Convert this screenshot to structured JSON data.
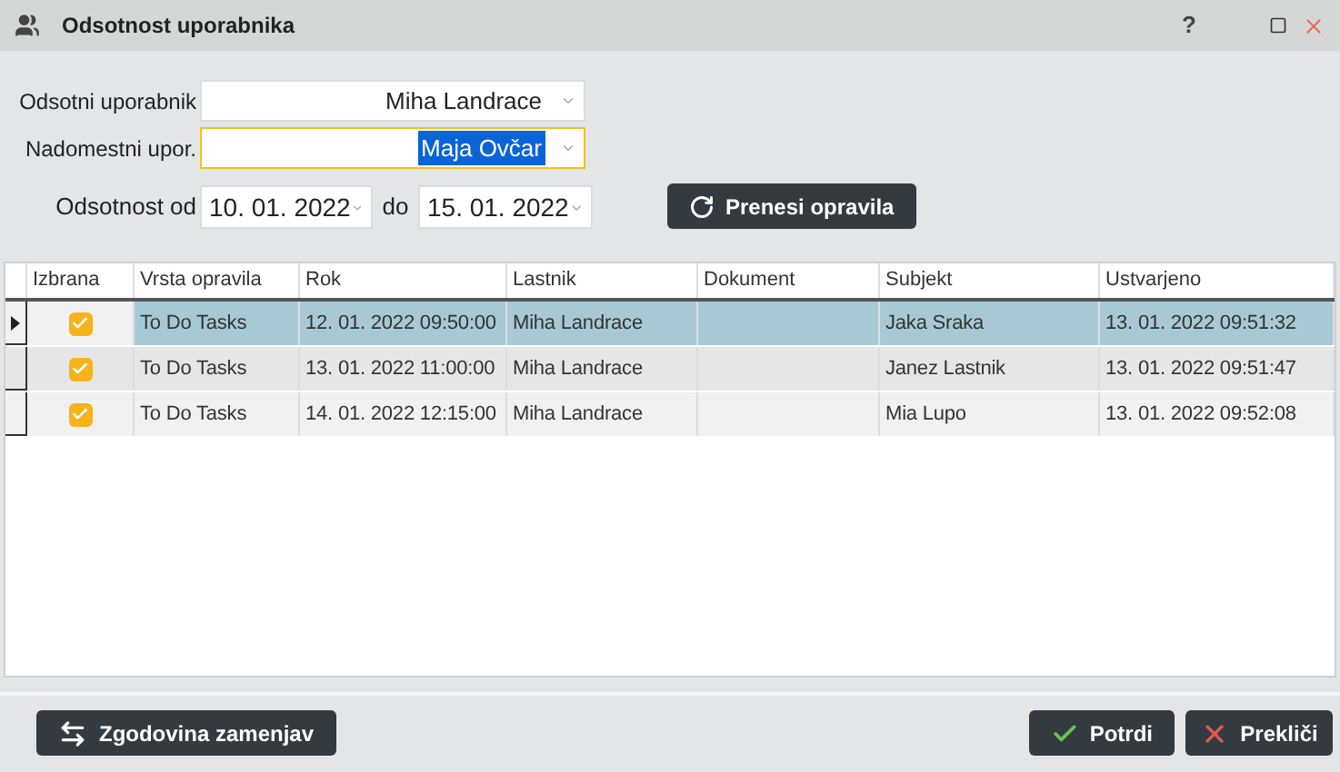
{
  "window": {
    "title": "Odsotnost uporabnika",
    "help": "?"
  },
  "form": {
    "absent_user": {
      "label": "Odsotni uporabnik",
      "value": "Miha Landrace",
      "focused": false
    },
    "substitute_user": {
      "label": "Nadomestni upor.",
      "value": "Maja Ovčar",
      "focused": true
    },
    "absence_from": {
      "label": "Odsotnost od",
      "value": "10. 01. 2022"
    },
    "to_label": "do",
    "absence_to": {
      "value": "15. 01. 2022"
    },
    "transfer_button": "Prenesi opravila"
  },
  "table": {
    "columns": [
      "Izbrana",
      "Vrsta opravila",
      "Rok",
      "Lastnik",
      "Dokument",
      "Subjekt",
      "Ustvarjeno"
    ],
    "rows": [
      {
        "selected": true,
        "checked": true,
        "type": "To Do Tasks",
        "deadline": "12. 01. 2022 09:50:00",
        "owner": "Miha Landrace",
        "subject": "Jaka Sraka",
        "created": "13. 01. 2022 09:51:32"
      },
      {
        "selected": false,
        "checked": true,
        "type": "To Do Tasks",
        "deadline": "13. 01. 2022 11:00:00",
        "owner": "Miha Landrace",
        "subject": "Janez Lastnik",
        "created": "13. 01. 2022 09:51:47"
      },
      {
        "selected": false,
        "checked": true,
        "type": "To Do Tasks",
        "deadline": "14. 01. 2022 12:15:00",
        "owner": "Miha Landrace",
        "subject": "Mia Lupo",
        "created": "13. 01. 2022 09:52:08"
      }
    ]
  },
  "footer": {
    "history_button": "Zgodovina zamenjav",
    "confirm_button": "Potrdi",
    "cancel_button": "Prekliči"
  }
}
